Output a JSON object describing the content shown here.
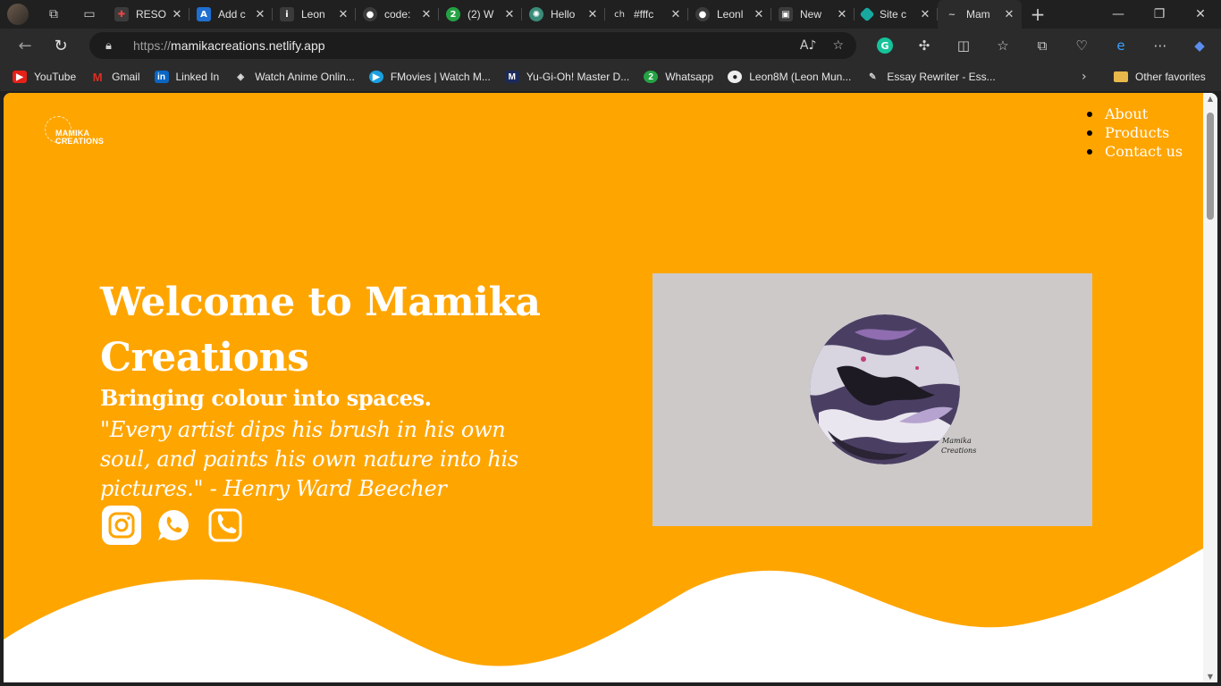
{
  "browser": {
    "tabs": [
      {
        "title": "RESO",
        "color": "#3b3b3b",
        "glyph": "✚"
      },
      {
        "title": "Add c",
        "color": "#1f6fd1",
        "glyph": "A"
      },
      {
        "title": "Leon",
        "color": "#3b3b3b",
        "glyph": "ℹ"
      },
      {
        "title": "code:",
        "color": "#3b3b3b",
        "glyph": "◉"
      },
      {
        "title": "(2) W",
        "color": "#25a244",
        "glyph": "2"
      },
      {
        "title": "Hello",
        "color": "#3a8c7a",
        "glyph": "✺"
      },
      {
        "title": "#fffc",
        "color": "#202020",
        "glyph": "ch"
      },
      {
        "title": "Leonl",
        "color": "#3b3b3b",
        "glyph": "◉"
      },
      {
        "title": "New",
        "color": "#3b3b3b",
        "glyph": "▣"
      },
      {
        "title": "Site c",
        "color": "#17a9a0",
        "glyph": "◆"
      },
      {
        "title": "Mam",
        "color": "#2b2b2b",
        "glyph": "~",
        "active": true
      }
    ],
    "url_prefix": "https://",
    "url_host": "mamikacreations.netlify.app",
    "bookmarks": [
      {
        "label": "YouTube",
        "color": "#e62117",
        "glyph": "▶"
      },
      {
        "label": "Gmail",
        "color": "#d93025",
        "glyph": "M"
      },
      {
        "label": "Linked In",
        "color": "#0a66c2",
        "glyph": "in"
      },
      {
        "label": "Watch Anime Onlin...",
        "color": "#2b2b2b",
        "glyph": "◈"
      },
      {
        "label": "FMovies | Watch M...",
        "color": "#1aa0e0",
        "glyph": "▶"
      },
      {
        "label": "Yu-Gi-Oh! Master D...",
        "color": "#1b2a5a",
        "glyph": "M"
      },
      {
        "label": "Whatsapp",
        "color": "#25a244",
        "glyph": "2"
      },
      {
        "label": "Leon8M (Leon Mun...",
        "color": "#2b2b2b",
        "glyph": "◉"
      },
      {
        "label": "Essay Rewriter - Ess...",
        "color": "#2b2b2b",
        "glyph": "✎"
      }
    ],
    "other_favorites": "Other favorites"
  },
  "site": {
    "logo_line1": "MAMIKA",
    "logo_line2": "CREATIONS",
    "nav": [
      "About",
      "Products",
      "Contact us"
    ],
    "headline": "Welcome to Mamika Creations",
    "tagline": "Bringing colour into spaces.",
    "quote": "\"Every artist dips his brush in his own soul, and paints his own nature into his pictures.\" - Henry Ward Beecher",
    "art_signature_1": "Mamika",
    "art_signature_2": "Creations",
    "colors": {
      "hero": "#ffa500",
      "text": "#ffffff"
    },
    "social_icons": [
      "instagram-icon",
      "whatsapp-icon",
      "phone-icon"
    ]
  }
}
